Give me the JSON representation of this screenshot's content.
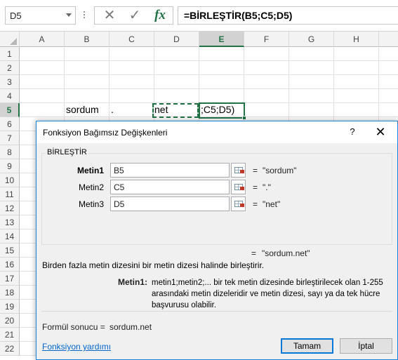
{
  "formula_bar": {
    "name_box": "D5",
    "fx": "fx",
    "formula": "=BİRLEŞTİR(B5;C5;D5)"
  },
  "grid": {
    "columns": [
      "A",
      "B",
      "C",
      "D",
      "E",
      "F",
      "G",
      "H"
    ],
    "active_column": "E",
    "rows": [
      "1",
      "2",
      "3",
      "4",
      "5",
      "6",
      "7",
      "8",
      "9",
      "10",
      "11",
      "12",
      "13",
      "14",
      "15",
      "16",
      "17",
      "18",
      "19",
      "20",
      "21",
      "22"
    ],
    "active_row": "5",
    "cells": {
      "B5": "sordum",
      "C5": ".",
      "D5": "net",
      "E5": ";C5;D5)"
    }
  },
  "dialog": {
    "title": "Fonksiyon Bağımsız Değişkenleri",
    "help": "?",
    "close": "✕",
    "function_name": "BİRLEŞTİR",
    "args": [
      {
        "label": "Metin1",
        "value": "B5",
        "eq": "=",
        "result": "\"sordum\""
      },
      {
        "label": "Metin2",
        "value": "C5",
        "eq": "=",
        "result": "\".\""
      },
      {
        "label": "Metin3",
        "value": "D5",
        "eq": "=",
        "result": "\"net\""
      }
    ],
    "result_eq": "=",
    "result_preview": "\"sordum.net\"",
    "description": "Birden fazla metin dizesini bir metin dizesi halinde birleştirir.",
    "arg_desc_name": "Metin1:",
    "arg_desc_text": "metin1;metin2;... bir tek metin dizesinde birleştirilecek olan 1-255 arasındaki metin dizeleridir ve metin dizesi, sayı ya da tek hücre başvurusu olabilir.",
    "formula_result_label": "Formül sonucu =",
    "formula_result_value": "sordum.net",
    "help_link": "Fonksiyon yardımı",
    "ok": "Tamam",
    "cancel": "İptal"
  },
  "colors": {
    "excel_green": "#217346",
    "dialog_border": "#1883d7",
    "link": "#0066cc"
  }
}
